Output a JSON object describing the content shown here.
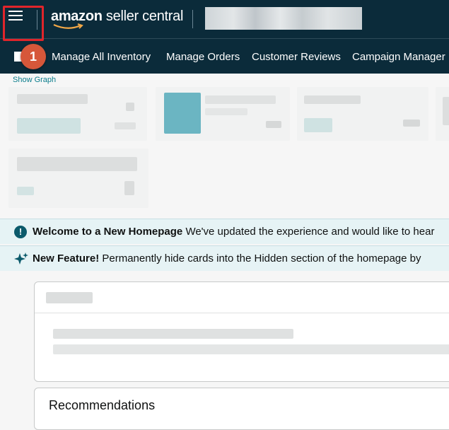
{
  "header": {
    "logo_bold": "amazon",
    "logo_rest": " seller central"
  },
  "annotation": {
    "step_number": "1"
  },
  "nav": {
    "items": [
      "Manage All Inventory",
      "Manage Orders",
      "Customer Reviews",
      "Campaign Manager"
    ]
  },
  "metrics": {
    "show_graph_label": "Show Graph"
  },
  "banners": {
    "welcome_bold": "Welcome to a New Homepage",
    "welcome_text": " We've updated the experience and would like to hear",
    "feature_bold": "New Feature!",
    "feature_text": " Permanently hide cards into the Hidden section of the homepage by"
  },
  "recommendations": {
    "title": "Recommendations"
  },
  "colors": {
    "header_bg": "#0b2b3a",
    "annotation_red": "#e0252b",
    "badge": "#d6573a",
    "banner_bg": "#e6f3f5",
    "link_teal": "#0a7d8c"
  }
}
